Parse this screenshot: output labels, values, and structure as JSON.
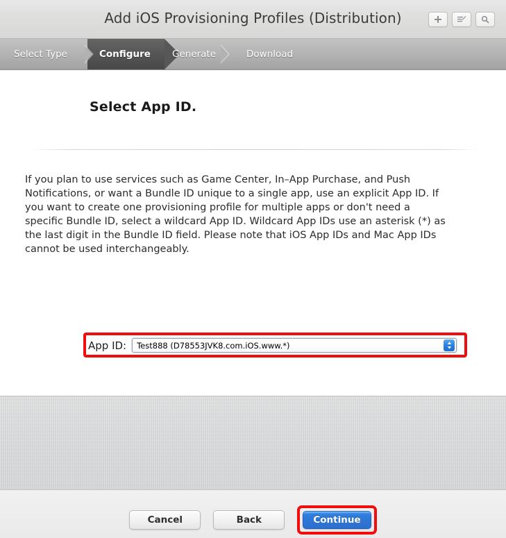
{
  "window": {
    "title": "Add iOS Provisioning Profiles (Distribution)",
    "title_buttons": [
      {
        "name": "add-button",
        "icon": "plus-icon",
        "label": "+"
      },
      {
        "name": "edit-button",
        "icon": "edit-pencil-icon",
        "label": "Edit"
      },
      {
        "name": "search-button",
        "icon": "search-icon",
        "label": "Search"
      }
    ]
  },
  "steps": [
    {
      "label": "Select Type",
      "active": false
    },
    {
      "label": "Configure",
      "active": true
    },
    {
      "label": "Generate",
      "active": false
    },
    {
      "label": "Download",
      "active": false
    }
  ],
  "main": {
    "heading": "Select App ID.",
    "body": "If you plan to use services such as Game Center, In–App Purchase, and Push Notifications, or want a Bundle ID unique to a single app, use an explicit App ID. If you want to create one provisioning profile for multiple apps or don't need a specific Bundle ID, select a wildcard App ID. Wildcard App IDs use an asterisk (*) as the last digit in the Bundle ID field. Please note that iOS App IDs and Mac App IDs cannot be used interchangeably.",
    "app_id": {
      "label": "App ID:",
      "selected": "Test888 (D78553JVK8.com.iOS.www.*)",
      "options": [
        "Test888 (D78553JVK8.com.iOS.www.*)"
      ]
    }
  },
  "footer": {
    "cancel_label": "Cancel",
    "back_label": "Back",
    "continue_label": "Continue"
  },
  "colors": {
    "highlight_red": "#f20d0d",
    "primary_blue": "#2d76d6",
    "stepbar_gray": "#b3b3b3",
    "active_step_gray": "#565555"
  }
}
